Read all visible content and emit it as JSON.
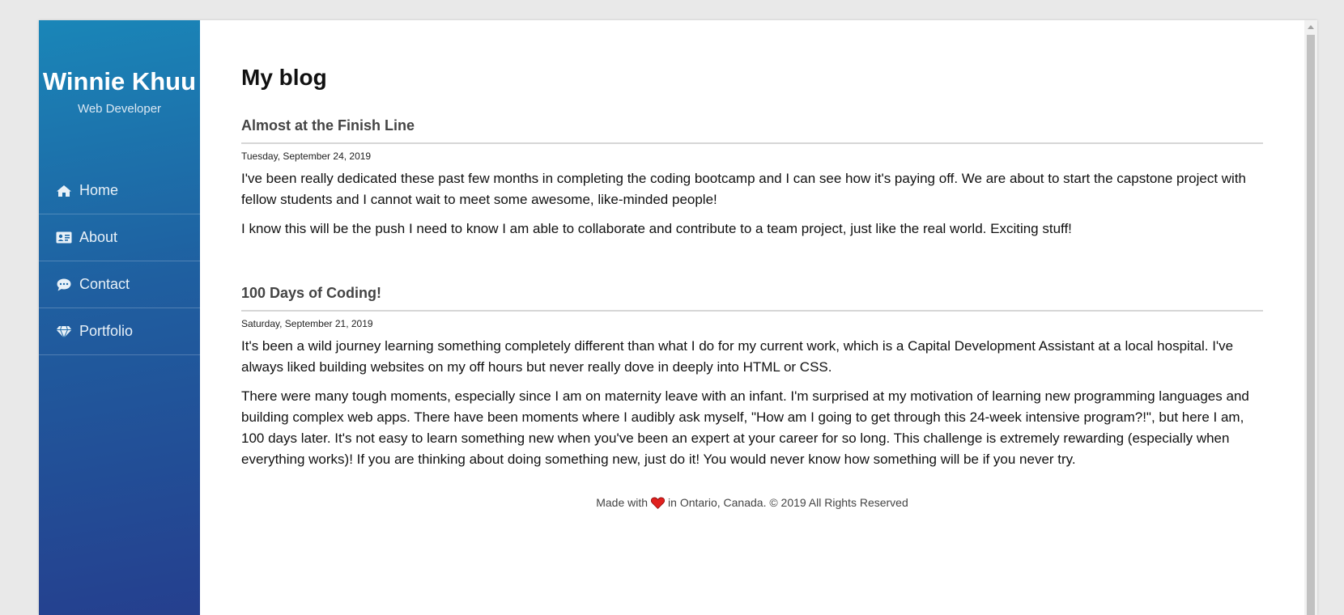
{
  "sidebar": {
    "name": "Winnie Khuu",
    "role": "Web Developer",
    "nav": [
      {
        "label": "Home",
        "icon": "home-icon"
      },
      {
        "label": "About",
        "icon": "id-card-icon"
      },
      {
        "label": "Contact",
        "icon": "chat-icon"
      },
      {
        "label": "Portfolio",
        "icon": "diamond-icon"
      }
    ]
  },
  "main": {
    "title": "My blog",
    "posts": [
      {
        "title": "Almost at the Finish Line",
        "date": "Tuesday, September 24, 2019",
        "paragraphs": [
          "I've been really dedicated these past few months in completing the coding bootcamp and I can see how it's paying off. We are about to start the capstone project with fellow students and I cannot wait to meet some awesome, like-minded people!",
          "I know this will be the push I need to know I am able to collaborate and contribute to a team project, just like the real world. Exciting stuff!"
        ]
      },
      {
        "title": "100 Days of Coding!",
        "date": "Saturday, September 21, 2019",
        "paragraphs": [
          "It's been a wild journey learning something completely different than what I do for my current work, which is a Capital Development Assistant at a local hospital. I've always liked building websites on my off hours but never really dove in deeply into HTML or CSS.",
          "There were many tough moments, especially since I am on maternity leave with an infant. I'm surprised at my motivation of learning new programming languages and building complex web apps. There have been moments where I audibly ask myself, \"How am I going to get through this 24-week intensive program?!\", but here I am, 100 days later. It's not easy to learn something new when you've been an expert at your career for so long. This challenge is extremely rewarding (especially when everything works)! If you are thinking about doing something new, just do it! You would never know how something will be if you never try."
        ]
      }
    ]
  },
  "footer": {
    "made_with": "Made with",
    "location": "in Ontario, Canada. © 2019 All Rights Reserved"
  },
  "colors": {
    "sidebar_top": "#1a86b8",
    "sidebar_bottom": "#253f8e",
    "heart": "#e0201e"
  }
}
